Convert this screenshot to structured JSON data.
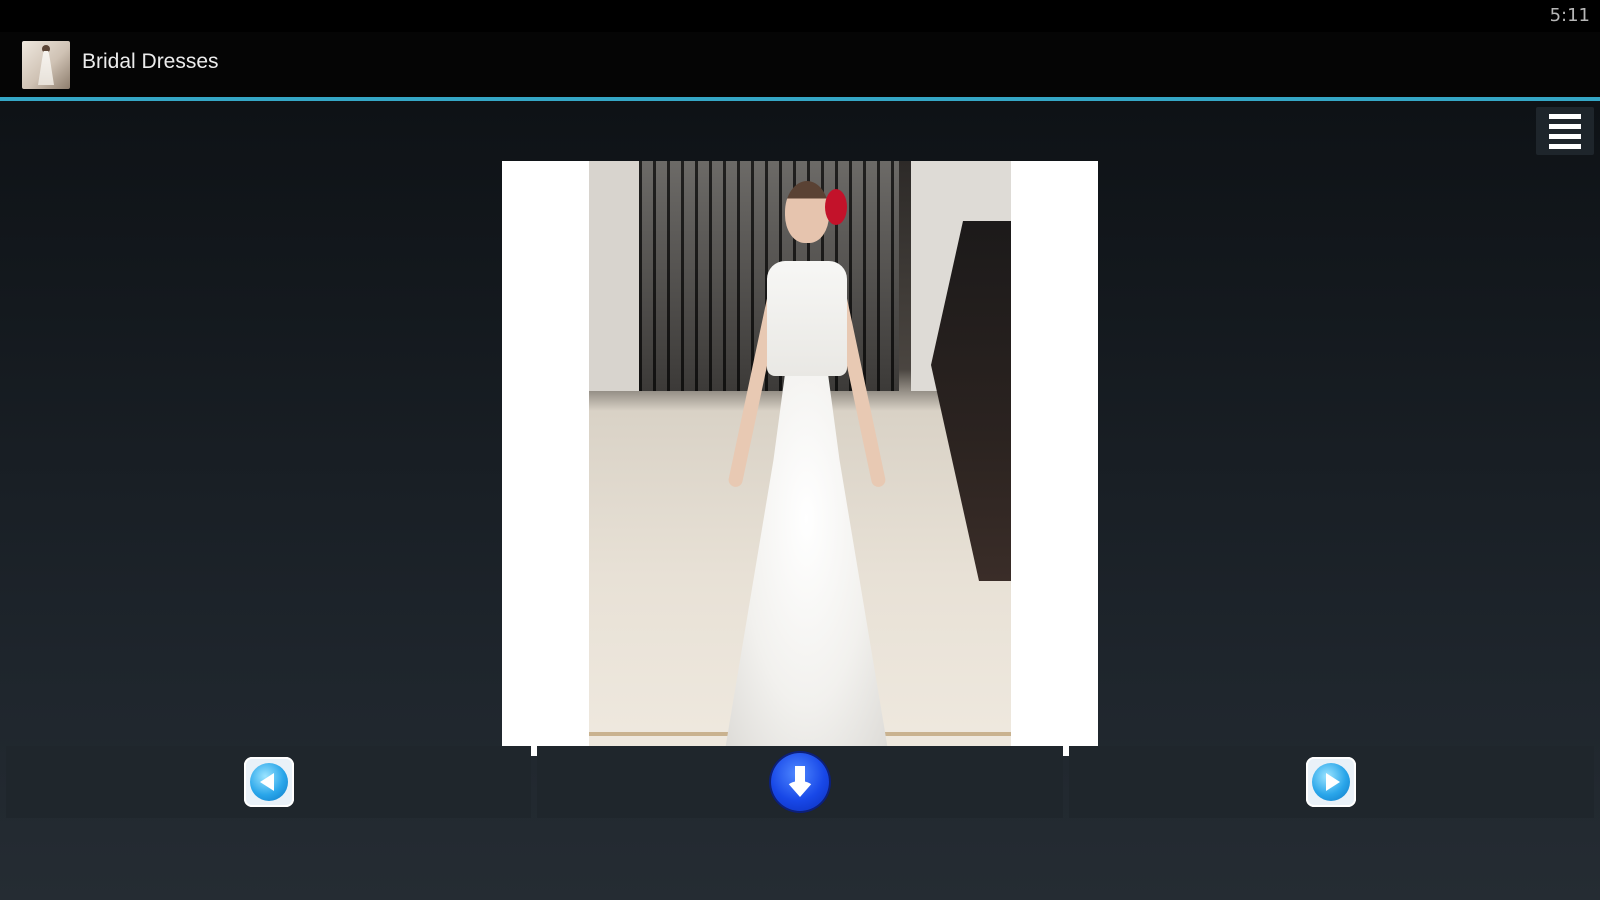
{
  "status_bar": {
    "time": "5:11"
  },
  "action_bar": {
    "title": "Bridal Dresses",
    "app_icon": "bridal-dress-app-icon",
    "accent_color": "#35a7c6"
  },
  "toolbar": {
    "menu_icon": "menu-icon"
  },
  "photo": {
    "subject": "bride-runway-photo"
  },
  "navigation": {
    "previous_icon": "previous-icon",
    "download_icon": "download-icon",
    "next_icon": "next-icon"
  }
}
